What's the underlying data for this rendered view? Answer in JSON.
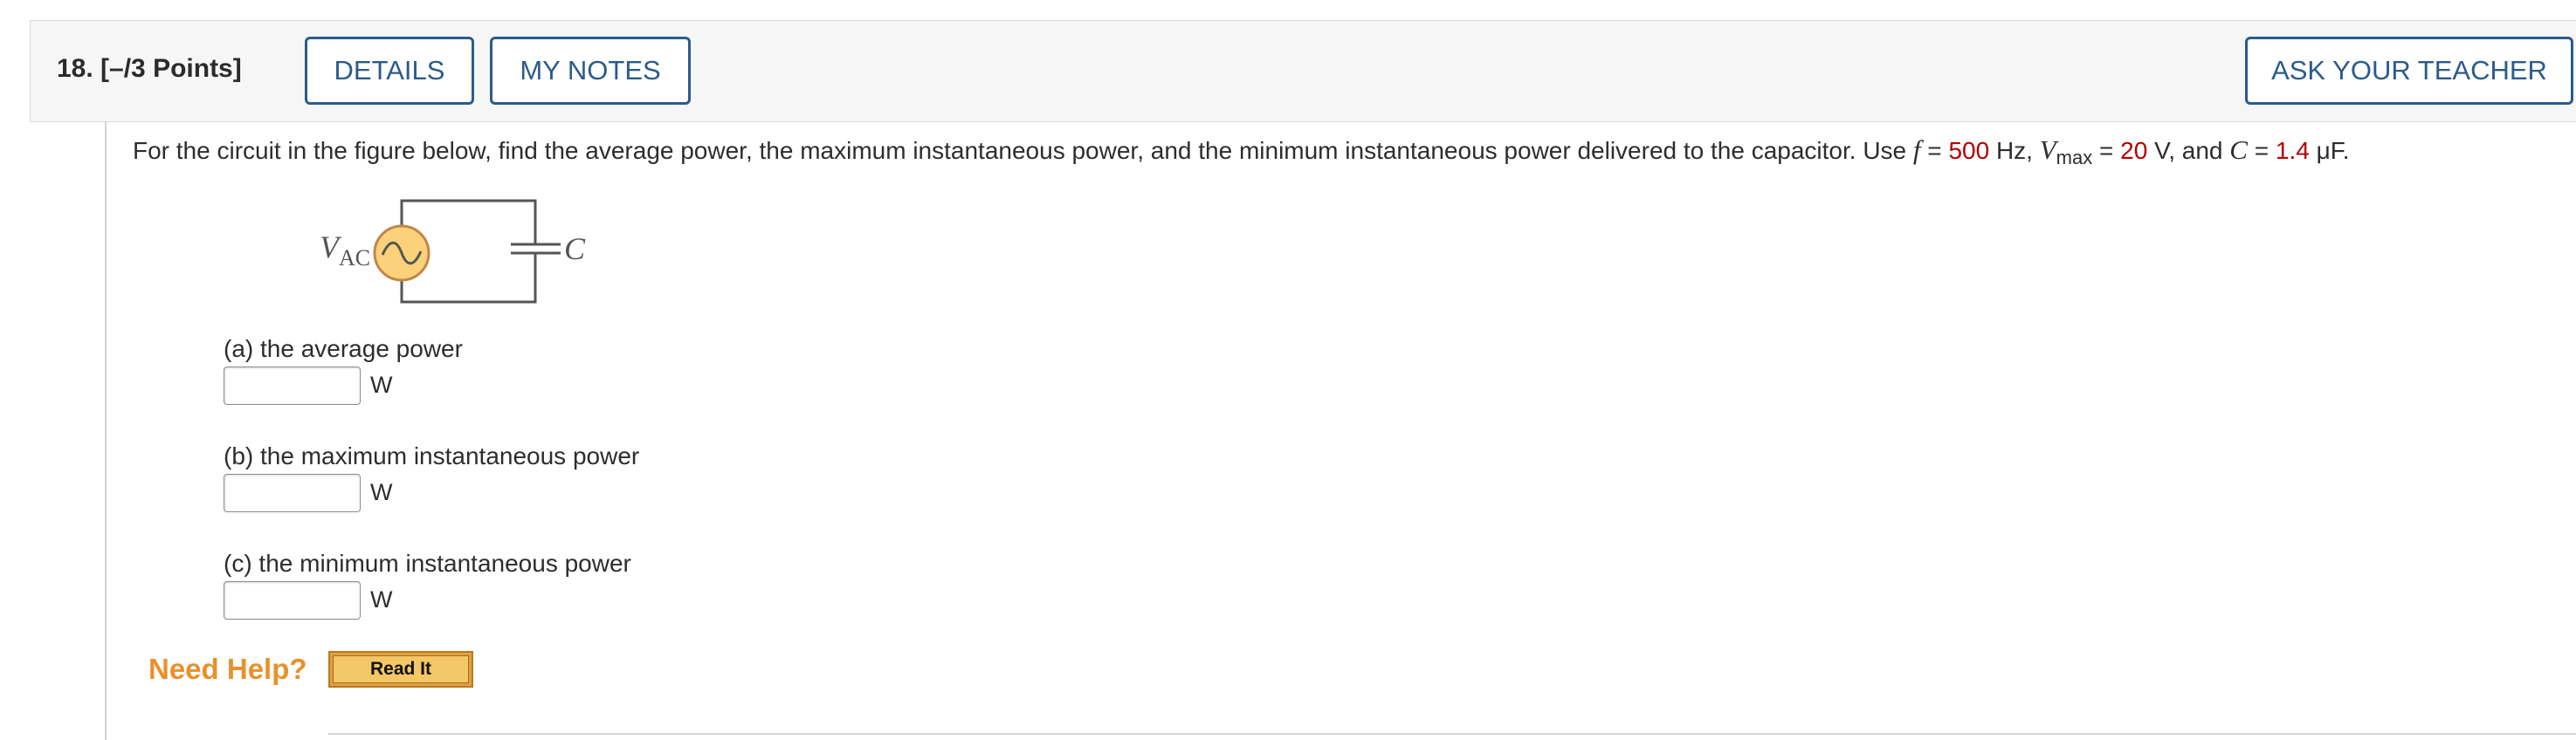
{
  "header": {
    "question_label": "18.  [–/3 Points]",
    "details_label": "DETAILS",
    "my_notes_label": "MY NOTES",
    "ask_teacher_label": "ASK YOUR TEACHER"
  },
  "question": {
    "text_before": "For the circuit in the figure below, find the average power, the maximum instantaneous power, and the minimum instantaneous power delivered to the capacitor. Use ",
    "f_symbol": "f",
    "eq1": " = ",
    "f_value": "500",
    "f_unit": " Hz, ",
    "v_symbol": "V",
    "v_sub": "max",
    "eq2": " = ",
    "v_value": "20",
    "v_unit": " V,  and ",
    "c_symbol": "C",
    "eq3": " = ",
    "c_value": "1.4",
    "c_unit": " μF."
  },
  "figure": {
    "source_label": "V",
    "source_sub": "AC",
    "capacitor_label": "C"
  },
  "parts": [
    {
      "label": "(a) the average power",
      "unit": "W",
      "value": ""
    },
    {
      "label": "(b) the maximum instantaneous power",
      "unit": "W",
      "value": ""
    },
    {
      "label": "(c) the minimum instantaneous power",
      "unit": "W",
      "value": ""
    }
  ],
  "help": {
    "label": "Need Help?",
    "read_it_label": "Read It"
  },
  "colors": {
    "brand_blue": "#2b5b8c",
    "given_value_red": "#b30000",
    "help_orange": "#e8912c",
    "source_fill": "#fbd27a"
  }
}
